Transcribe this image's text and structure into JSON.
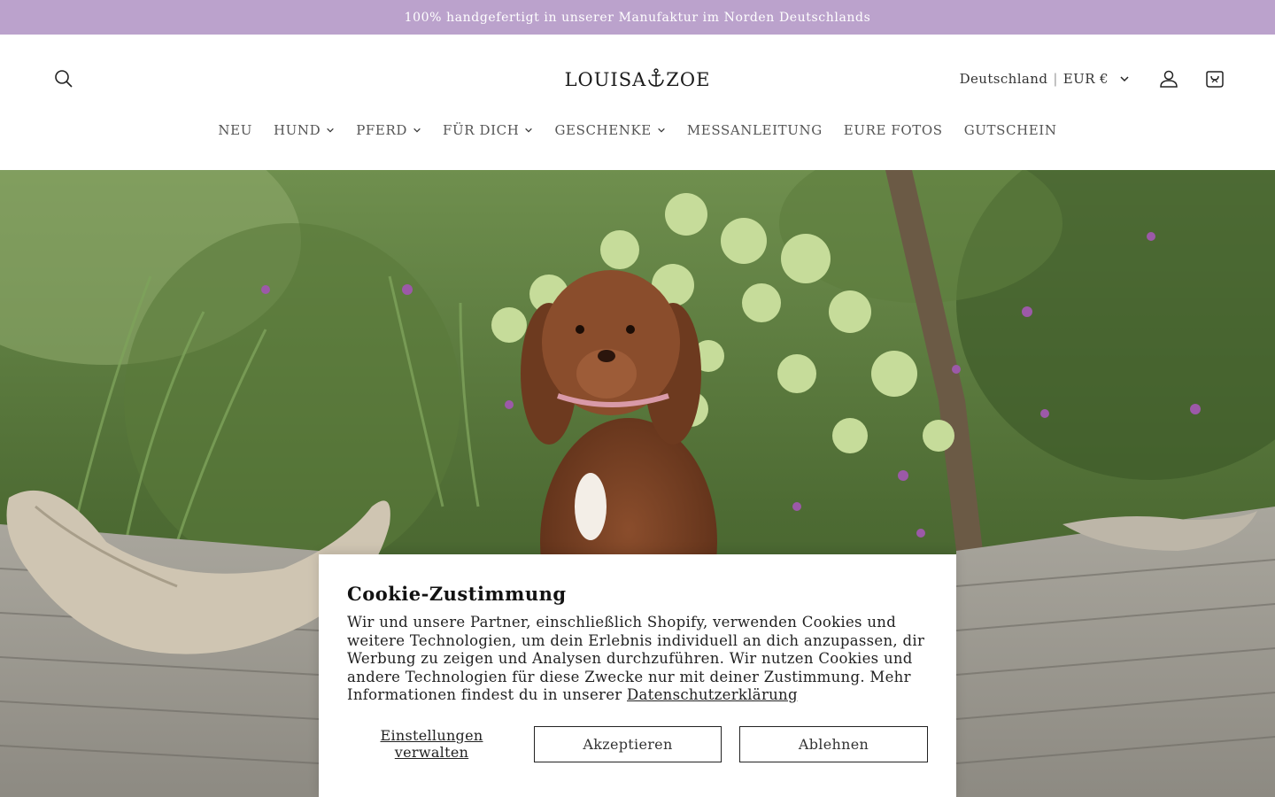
{
  "announcement": {
    "text": "100% handgefertigt in unserer Manufaktur im Norden Deutschlands"
  },
  "header": {
    "logo_left": "LOUISA",
    "logo_right": "ZOE",
    "locale_country": "Deutschland",
    "locale_sep": "|",
    "locale_currency": "EUR €",
    "icons": {
      "search": "search-icon",
      "account": "user-icon",
      "cart": "cart-icon"
    }
  },
  "nav": {
    "items": [
      {
        "label": "NEU",
        "dropdown": false
      },
      {
        "label": "HUND",
        "dropdown": true
      },
      {
        "label": "PFERD",
        "dropdown": true
      },
      {
        "label": "FÜR DICH",
        "dropdown": true
      },
      {
        "label": "GESCHENKE",
        "dropdown": true
      },
      {
        "label": "MESSANLEITUNG",
        "dropdown": false
      },
      {
        "label": "EURE FOTOS",
        "dropdown": false
      },
      {
        "label": "GUTSCHEIN",
        "dropdown": false
      }
    ]
  },
  "cookie": {
    "title": "Cookie-Zustimmung",
    "body": "Wir und unsere Partner, einschließlich Shopify, verwenden Cookies und weitere Technologien, um dein Erlebnis individuell an dich anzupassen, dir Werbung zu zeigen und Analysen durchzuführen. Wir nutzen Cookies und andere Technologien für diese Zwecke nur mit deiner Zustimmung. Mehr Informationen findest du in unserer",
    "privacy_link": "Datenschutzerklärung",
    "manage_label": "Einstellungen verwalten",
    "accept_label": "Akzeptieren",
    "decline_label": "Ablehnen"
  },
  "colors": {
    "announcement_bg": "#bba2cc"
  }
}
